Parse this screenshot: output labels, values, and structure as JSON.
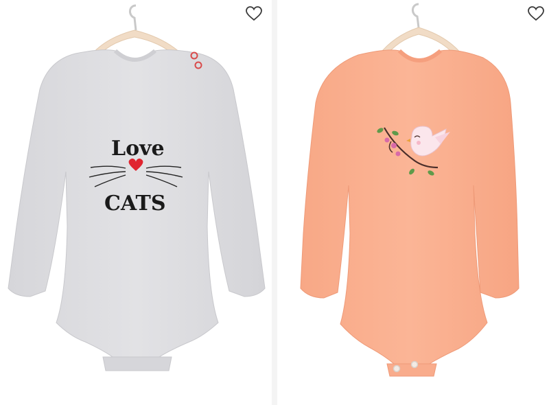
{
  "products": [
    {
      "id_label": "left",
      "favorite_icon": "heart-outline-icon",
      "garment_color": "#dddde0",
      "print": {
        "line1": "Love",
        "line2": "CATS",
        "heart_color": "#e0242f"
      },
      "snap_color": "#d94b4b"
    },
    {
      "id_label": "right",
      "favorite_icon": "heart-outline-icon",
      "garment_color": "#fbb294",
      "print": {
        "motif": "bird-on-branch"
      },
      "snap_color": "#f0e6df"
    }
  ],
  "colors": {
    "hanger": "#f1dcc6",
    "hook": "#c9c9c9",
    "icon_stroke": "#3a3a3a"
  }
}
